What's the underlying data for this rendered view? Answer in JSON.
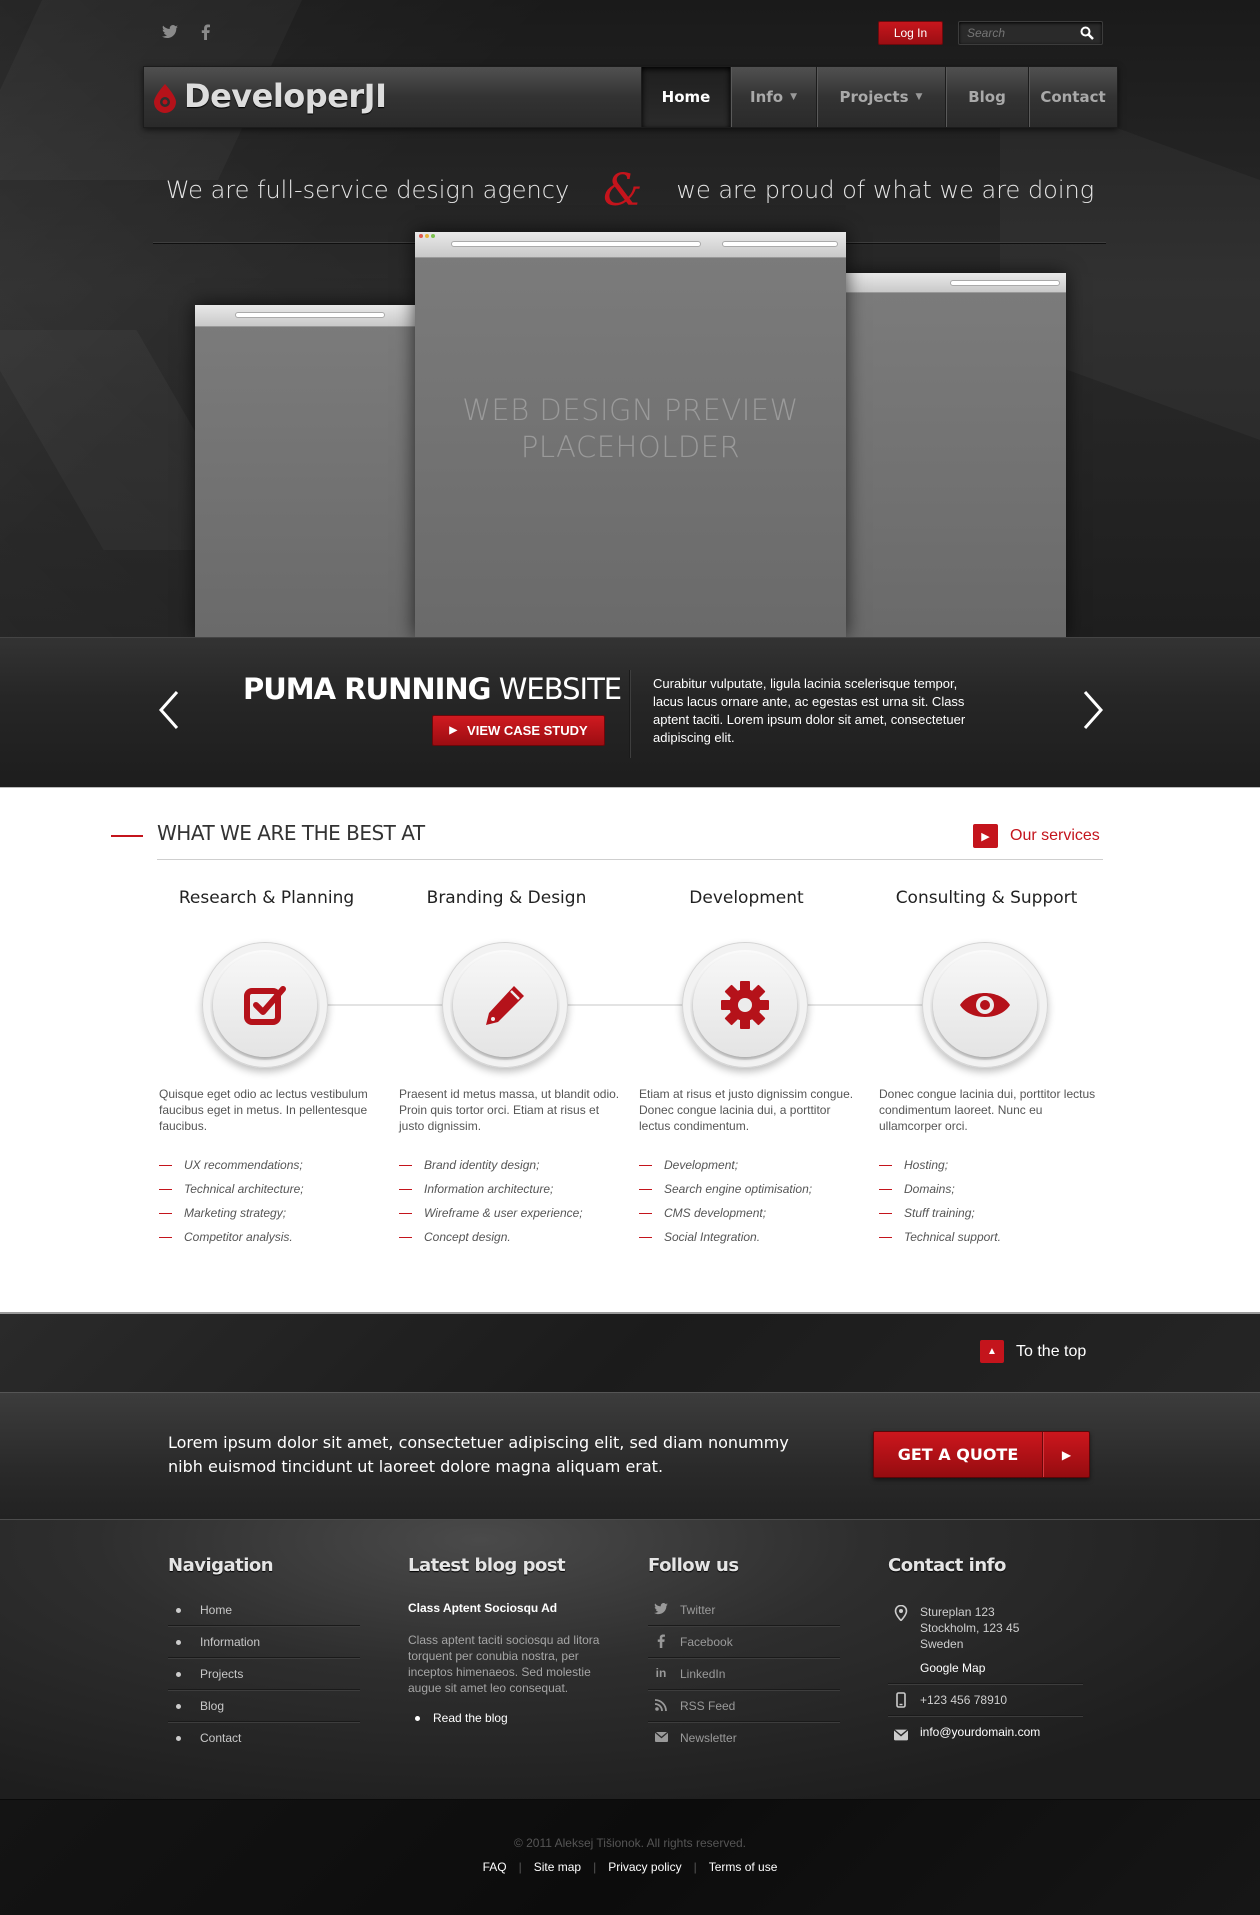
{
  "topbar": {
    "social": [
      "twitter-icon",
      "facebook-icon"
    ],
    "login_label": "Log In",
    "search_placeholder": "Search"
  },
  "header": {
    "logo_text": "DeveloperJI",
    "nav": [
      {
        "label": "Home",
        "active": true,
        "dropdown": false
      },
      {
        "label": "Info",
        "active": false,
        "dropdown": true
      },
      {
        "label": "Projects",
        "active": false,
        "dropdown": true
      },
      {
        "label": "Blog",
        "active": false,
        "dropdown": false
      },
      {
        "label": "Contact",
        "active": false,
        "dropdown": false
      }
    ]
  },
  "hero": {
    "tagline_left": "We are full-service design agency",
    "tagline_amp": "&",
    "tagline_right": "we are proud of what we are doing",
    "preview_line1": "WEB DESIGN PREVIEW",
    "preview_line2": "PLACEHOLDER"
  },
  "slider": {
    "title_bold": "PUMA RUNNING",
    "title_light": "WEBSITE",
    "button_label": "VIEW CASE STUDY",
    "description": "Curabitur vulputate, ligula lacinia scelerisque tempor, lacus lacus ornare ante, ac egestas est urna sit. Class aptent taciti. Lorem ipsum dolor sit amet, consectetuer adipiscing elit."
  },
  "services": {
    "heading": "WHAT WE ARE THE BEST AT",
    "link_label": "Our services",
    "columns": [
      {
        "title": "Research & Planning",
        "icon": "checkbox-icon",
        "desc": "Quisque eget odio ac lectus vestibulum faucibus eget in metus. In pellentesque faucibus.",
        "items": [
          "UX recommendations;",
          "Technical architecture;",
          "Marketing strategy;",
          "Competitor analysis."
        ]
      },
      {
        "title": "Branding & Design",
        "icon": "pencil-icon",
        "desc": "Praesent id metus massa, ut blandit odio. Proin quis tortor orci. Etiam at risus et justo dignissim.",
        "items": [
          "Brand identity design;",
          "Information architecture;",
          "Wireframe & user experience;",
          "Concept design."
        ]
      },
      {
        "title": "Development",
        "icon": "gear-icon",
        "desc": "Etiam at risus et justo dignissim congue. Donec congue lacinia dui, a porttitor lectus condimentum.",
        "items": [
          "Development;",
          "Search engine optimisation;",
          "CMS development;",
          "Social Integration."
        ]
      },
      {
        "title": "Consulting & Support",
        "icon": "eye-icon",
        "desc": "Donec congue lacinia dui, porttitor lectus condimentum laoreet. Nunc eu ullamcorper orci.",
        "items": [
          "Hosting;",
          "Domains;",
          "Stuff training;",
          "Technical support."
        ]
      }
    ]
  },
  "totop": {
    "label": "To the top"
  },
  "quote": {
    "text": "Lorem ipsum dolor sit amet, consectetuer adipiscing elit, sed diam nonummy nibh euismod tincidunt ut laoreet dolore magna aliquam erat.",
    "button_label": "GET A QUOTE"
  },
  "footer": {
    "nav_title": "Navigation",
    "nav_items": [
      "Home",
      "Information",
      "Projects",
      "Blog",
      "Contact"
    ],
    "blog_title": "Latest blog post",
    "blog_post_title": "Class Aptent Sociosqu Ad",
    "blog_excerpt": "Class aptent taciti sociosqu ad litora torquent per conubia nostra, per inceptos himenaeos. Sed molestie augue sit amet leo consequat.",
    "blog_read": "Read the blog",
    "follow_title": "Follow us",
    "follow_items": [
      {
        "label": "Twitter",
        "icon": "twitter-icon"
      },
      {
        "label": "Facebook",
        "icon": "facebook-icon"
      },
      {
        "label": "LinkedIn",
        "icon": "linkedin-icon"
      },
      {
        "label": "RSS Feed",
        "icon": "rss-icon"
      },
      {
        "label": "Newsletter",
        "icon": "envelope-icon"
      }
    ],
    "contact_title": "Contact info",
    "address_line1": "Stureplan 123",
    "address_line2": "Stockholm, 123 45",
    "address_line3": "Sweden",
    "map_link": "Google Map",
    "phone": "+123 456 78910",
    "email": "info@yourdomain.com"
  },
  "bottom": {
    "copyright": "© 2011 Aleksej Tišionok. All rights reserved.",
    "links": [
      "FAQ",
      "Site map",
      "Privacy policy",
      "Terms of use"
    ]
  },
  "colors": {
    "accent": "#c4141c",
    "dark_bg": "#1e1e1e",
    "white_bg": "#ffffff"
  }
}
